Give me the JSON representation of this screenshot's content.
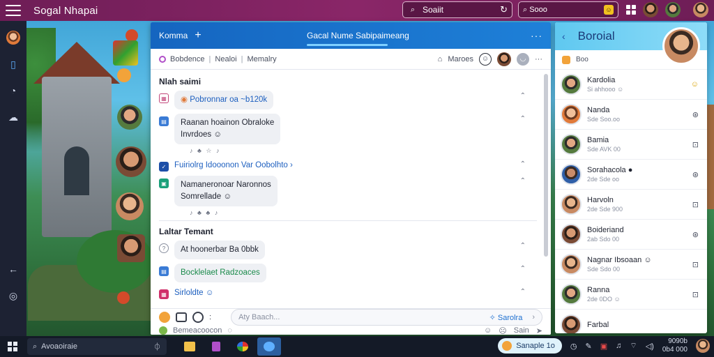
{
  "topbar": {
    "title": "Sogal Nhapai",
    "search1_text": "Soaiit",
    "search2_text": "Sooo",
    "search2_badge": "☺"
  },
  "chat": {
    "tab_label": "Komma",
    "header_title": "Gacal Nume Sabipaimeang",
    "subbar": {
      "item1": "Bobdence",
      "item2": "Nealoi",
      "item3": "Memalry",
      "right_label": "Maroes"
    },
    "sections": [
      {
        "title": "Nlah saimi",
        "items": [
          {
            "type": "bubble",
            "text": "Pobronnar oa ~b120k",
            "style": "blue"
          },
          {
            "type": "bubble",
            "text": "Raanan hoainon Obraloke",
            "line2": "Invrdoes ☺",
            "reacts": "♪ ♣ ☆ ♪"
          },
          {
            "type": "link",
            "text": "Fuiriolrg Idooonon Var Oobolhto ›"
          },
          {
            "type": "bubble",
            "text": "Namaneronoar Naronnos",
            "line2": "Somrellade ☺",
            "reacts": "♪ ♣ ♣ ♪"
          }
        ]
      },
      {
        "title": "Laltar Temant",
        "items": [
          {
            "type": "bubble",
            "text": "At hoonerbar Ba 0bbk"
          },
          {
            "type": "bubble",
            "text": "Bocklelaet Radzoaces",
            "style": "green"
          },
          {
            "type": "link",
            "text": "Sirloldte ☺"
          }
        ]
      }
    ],
    "composer": {
      "placeholder": "Aty Baach...",
      "send_label": "Sarolra",
      "second_line": "Bemeacoocon",
      "second_right": "Sain"
    }
  },
  "rpanel": {
    "title": "Boroial",
    "search_text": "Boo",
    "contacts": [
      {
        "name": "Kardolia",
        "sub": "Si ahhooo ☺",
        "action": "☺"
      },
      {
        "name": "Nanda",
        "sub": "Sde Soo.oo",
        "action": "⊛"
      },
      {
        "name": "Bamia",
        "sub": "Sde AVK 00",
        "action": "⊡"
      },
      {
        "name": "Sorahacola ●",
        "sub": "2de Sde oo",
        "action": "⊛"
      },
      {
        "name": "Harvoln",
        "sub": "2de Sde 900",
        "action": "⊡"
      },
      {
        "name": "Boideriand",
        "sub": "2ab Sdo 00",
        "action": "⊛"
      },
      {
        "name": "Nagnar Ibsoaan ☺",
        "sub": "Sde Sdo 00",
        "action": "⊡"
      },
      {
        "name": "Ranna",
        "sub": "2de 0DO ☺",
        "action": "⊡"
      },
      {
        "name": "Farbal",
        "sub": "",
        "action": ""
      }
    ]
  },
  "taskbar": {
    "search_text": "Avoaoiraie",
    "pill_text": "Sanaple 1o",
    "clock_top": "9090b",
    "clock_bottom": "0b4 000"
  },
  "colors": {
    "topbar": "#8a2668",
    "chat_header": "#1565c0",
    "rpanel_header": "#5fc8f0",
    "taskbar": "#141a27"
  }
}
